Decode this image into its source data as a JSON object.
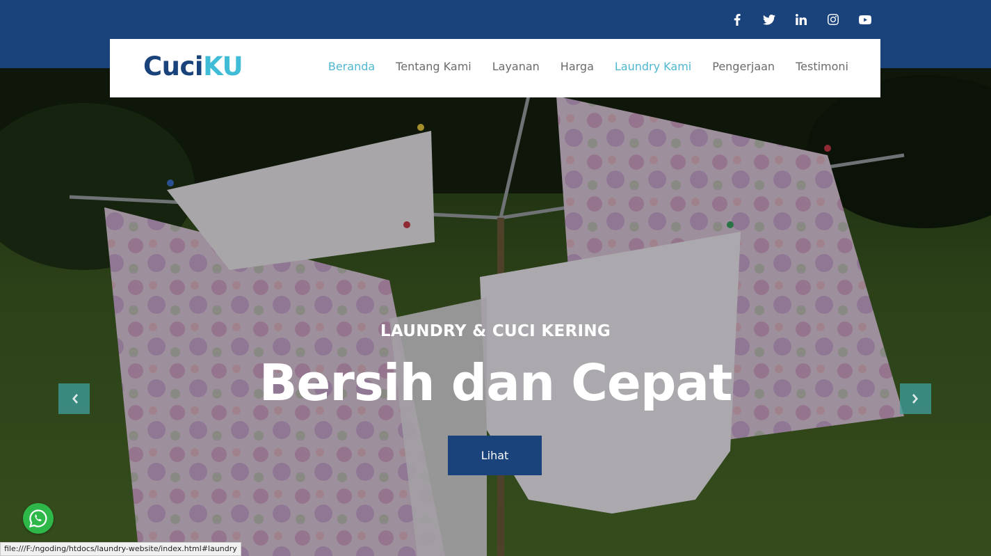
{
  "social": [
    {
      "icon": "facebook-icon"
    },
    {
      "icon": "twitter-icon"
    },
    {
      "icon": "linkedin-icon"
    },
    {
      "icon": "instagram-icon"
    },
    {
      "icon": "youtube-icon"
    }
  ],
  "brand": {
    "part1": "Cuci",
    "part2": "KU",
    "color1": "#1a437c",
    "color2": "#40bcd6"
  },
  "nav": {
    "items": [
      {
        "label": "Beranda",
        "active": true
      },
      {
        "label": "Tentang Kami",
        "active": false
      },
      {
        "label": "Layanan",
        "active": false
      },
      {
        "label": "Harga",
        "active": false
      },
      {
        "label": "Laundry Kami",
        "active": true
      },
      {
        "label": "Pengerjaan",
        "active": false
      },
      {
        "label": "Testimoni",
        "active": false
      }
    ],
    "active_color": "#4fb7d0"
  },
  "hero": {
    "subtitle": "LAUNDRY & CUCI KERING",
    "title": "Bersih dan Cepat",
    "cta_label": "Lihat",
    "prev_icon": "chevron-left-icon",
    "next_icon": "chevron-right-icon"
  },
  "whatsapp": {
    "icon": "whatsapp-icon"
  },
  "statusbar": {
    "url": "file:///F:/ngoding/htdocs/laundry-website/index.html#laundry"
  },
  "colors": {
    "primary": "#1a437c",
    "accent": "#40bcd6"
  }
}
